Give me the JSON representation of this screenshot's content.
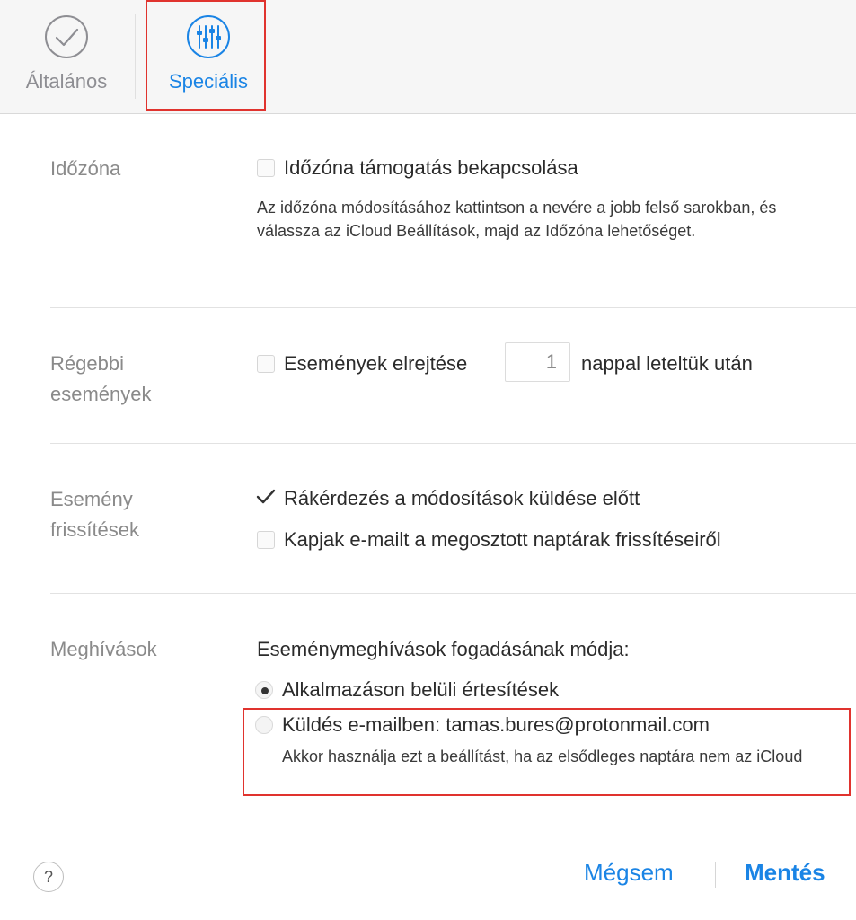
{
  "toolbar": {
    "tabs": [
      {
        "label": "Általános",
        "icon": "checkmark-circle-icon"
      },
      {
        "label": "Speciális",
        "icon": "sliders-icon"
      }
    ]
  },
  "sections": {
    "timezone": {
      "label": "Időzóna",
      "checkbox_label": "Időzóna támogatás bekapcsolása",
      "checked": false,
      "help": "Az időzóna módosításához kattintson a nevére a jobb felső sarokban, és válassza az iCloud Beállítások, majd az Időzóna lehetőséget."
    },
    "older_events": {
      "label": "Régebbi események",
      "checkbox_label_before": "Események elrejtése",
      "days_value": "1",
      "checkbox_label_after": "nappal leteltük után",
      "checked": false
    },
    "event_updates": {
      "label": "Esemény frissítések",
      "options": [
        {
          "label": "Rákérdezés a módosítások küldése előtt",
          "checked": true
        },
        {
          "label": "Kapjak e-mailt a megosztott naptárak frissítéseiről",
          "checked": false
        }
      ]
    },
    "invitations": {
      "label": "Meghívások",
      "prompt": "Eseménymeghívások fogadásának módja:",
      "options": [
        {
          "label": "Alkalmazáson belüli értesítések",
          "selected": true
        },
        {
          "label": "Küldés e-mailben: tamas.bures@protonmail.com",
          "selected": false
        }
      ],
      "email_help": "Akkor használja ezt a beállítást, ha az elsődleges naptára nem az iCloud"
    }
  },
  "footer": {
    "help_label": "?",
    "cancel_label": "Mégsem",
    "save_label": "Mentés"
  },
  "colors": {
    "accent": "#1a84e5",
    "highlight": "#e0332e",
    "label_gray": "#8a8a8a"
  }
}
